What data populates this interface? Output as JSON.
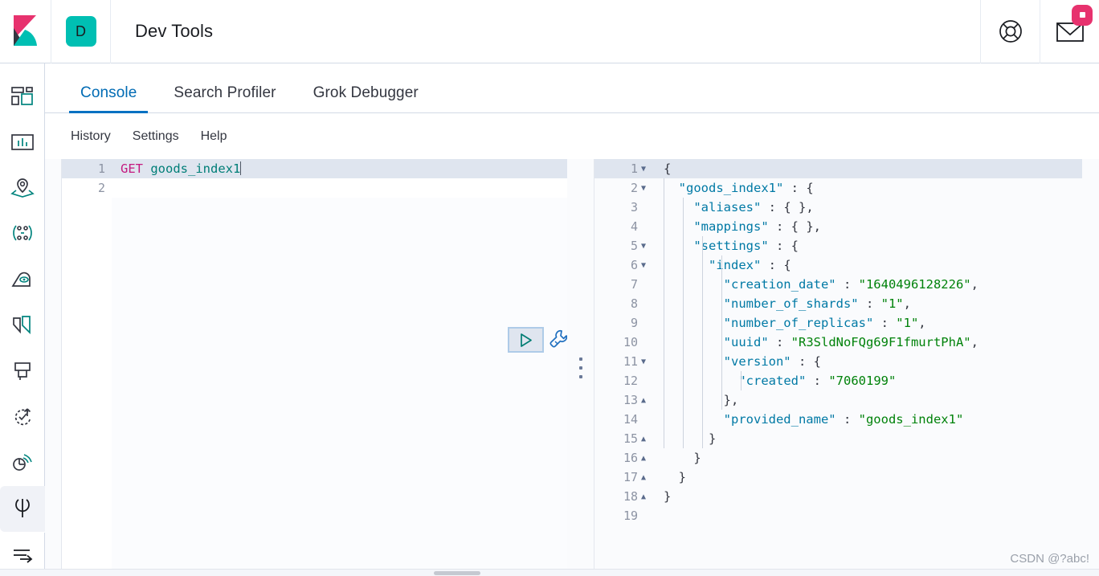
{
  "header": {
    "logo_icon": "kibana-logo",
    "space_initial": "D",
    "title": "Dev Tools",
    "help_icon": "lifebuoy-help-icon",
    "mail_icon": "envelope-news-icon",
    "mail_badge": ""
  },
  "sidebar": {
    "items": [
      {
        "icon": "dashboard-layout-icon",
        "name": "overview"
      },
      {
        "icon": "dashboard-panel-icon",
        "name": "dashboard"
      },
      {
        "icon": "maps-location-icon",
        "name": "maps"
      },
      {
        "icon": "graph-nodes-icon",
        "name": "graph"
      },
      {
        "icon": "ml-brain-icon",
        "name": "machine-learning"
      },
      {
        "icon": "canvas-pages-icon",
        "name": "canvas"
      },
      {
        "icon": "logs-stream-icon",
        "name": "logs"
      },
      {
        "icon": "uptime-clock-arrow-icon",
        "name": "uptime"
      },
      {
        "icon": "apm-signal-icon",
        "name": "apm"
      },
      {
        "icon": "wrench-devtools-icon",
        "name": "dev-tools",
        "active": true
      }
    ],
    "collapse_icon": "collapse-arrow-icon"
  },
  "tabs": [
    {
      "label": "Console",
      "active": true
    },
    {
      "label": "Search Profiler",
      "active": false
    },
    {
      "label": "Grok Debugger",
      "active": false
    }
  ],
  "sublinks": [
    {
      "label": "History"
    },
    {
      "label": "Settings"
    },
    {
      "label": "Help"
    }
  ],
  "request_editor": {
    "lines": [
      {
        "no": "1",
        "method": "GET",
        "url": " goods_index1",
        "cursor": true
      },
      {
        "no": "2",
        "method": "",
        "url": ""
      }
    ]
  },
  "actions": {
    "run_icon": "play-triangle-icon",
    "wrench_icon": "wrench-icon"
  },
  "splitter": {
    "icon": "drag-handle-dots-icon"
  },
  "response_editor": {
    "lines": [
      {
        "no": "1",
        "fold": "down",
        "text": "{"
      },
      {
        "no": "2",
        "fold": "down",
        "text": "  \"goods_index1\" : {"
      },
      {
        "no": "3",
        "fold": "",
        "text": "    \"aliases\" : { },"
      },
      {
        "no": "4",
        "fold": "",
        "text": "    \"mappings\" : { },"
      },
      {
        "no": "5",
        "fold": "down",
        "text": "    \"settings\" : {"
      },
      {
        "no": "6",
        "fold": "down",
        "text": "      \"index\" : {"
      },
      {
        "no": "7",
        "fold": "",
        "text": "        \"creation_date\" : \"1640496128226\","
      },
      {
        "no": "8",
        "fold": "",
        "text": "        \"number_of_shards\" : \"1\","
      },
      {
        "no": "9",
        "fold": "",
        "text": "        \"number_of_replicas\" : \"1\","
      },
      {
        "no": "10",
        "fold": "",
        "text": "        \"uuid\" : \"R3SldNoFQg69F1fmurtPhA\","
      },
      {
        "no": "11",
        "fold": "down",
        "text": "        \"version\" : {"
      },
      {
        "no": "12",
        "fold": "",
        "text": "          \"created\" : \"7060199\""
      },
      {
        "no": "13",
        "fold": "up",
        "text": "        },"
      },
      {
        "no": "14",
        "fold": "",
        "text": "        \"provided_name\" : \"goods_index1\""
      },
      {
        "no": "15",
        "fold": "up",
        "text": "      }"
      },
      {
        "no": "16",
        "fold": "up",
        "text": "    }"
      },
      {
        "no": "17",
        "fold": "up",
        "text": "  }"
      },
      {
        "no": "18",
        "fold": "up",
        "text": "}"
      },
      {
        "no": "19",
        "fold": "",
        "text": ""
      }
    ]
  },
  "watermark": "CSDN @?abc!",
  "colors": {
    "accent_blue": "#0071c2",
    "teal": "#00BFB3",
    "pink": "#E7326E",
    "method": "#C4197F",
    "url": "#007E77",
    "json_key": "#0079a5",
    "json_string": "#00820a"
  }
}
